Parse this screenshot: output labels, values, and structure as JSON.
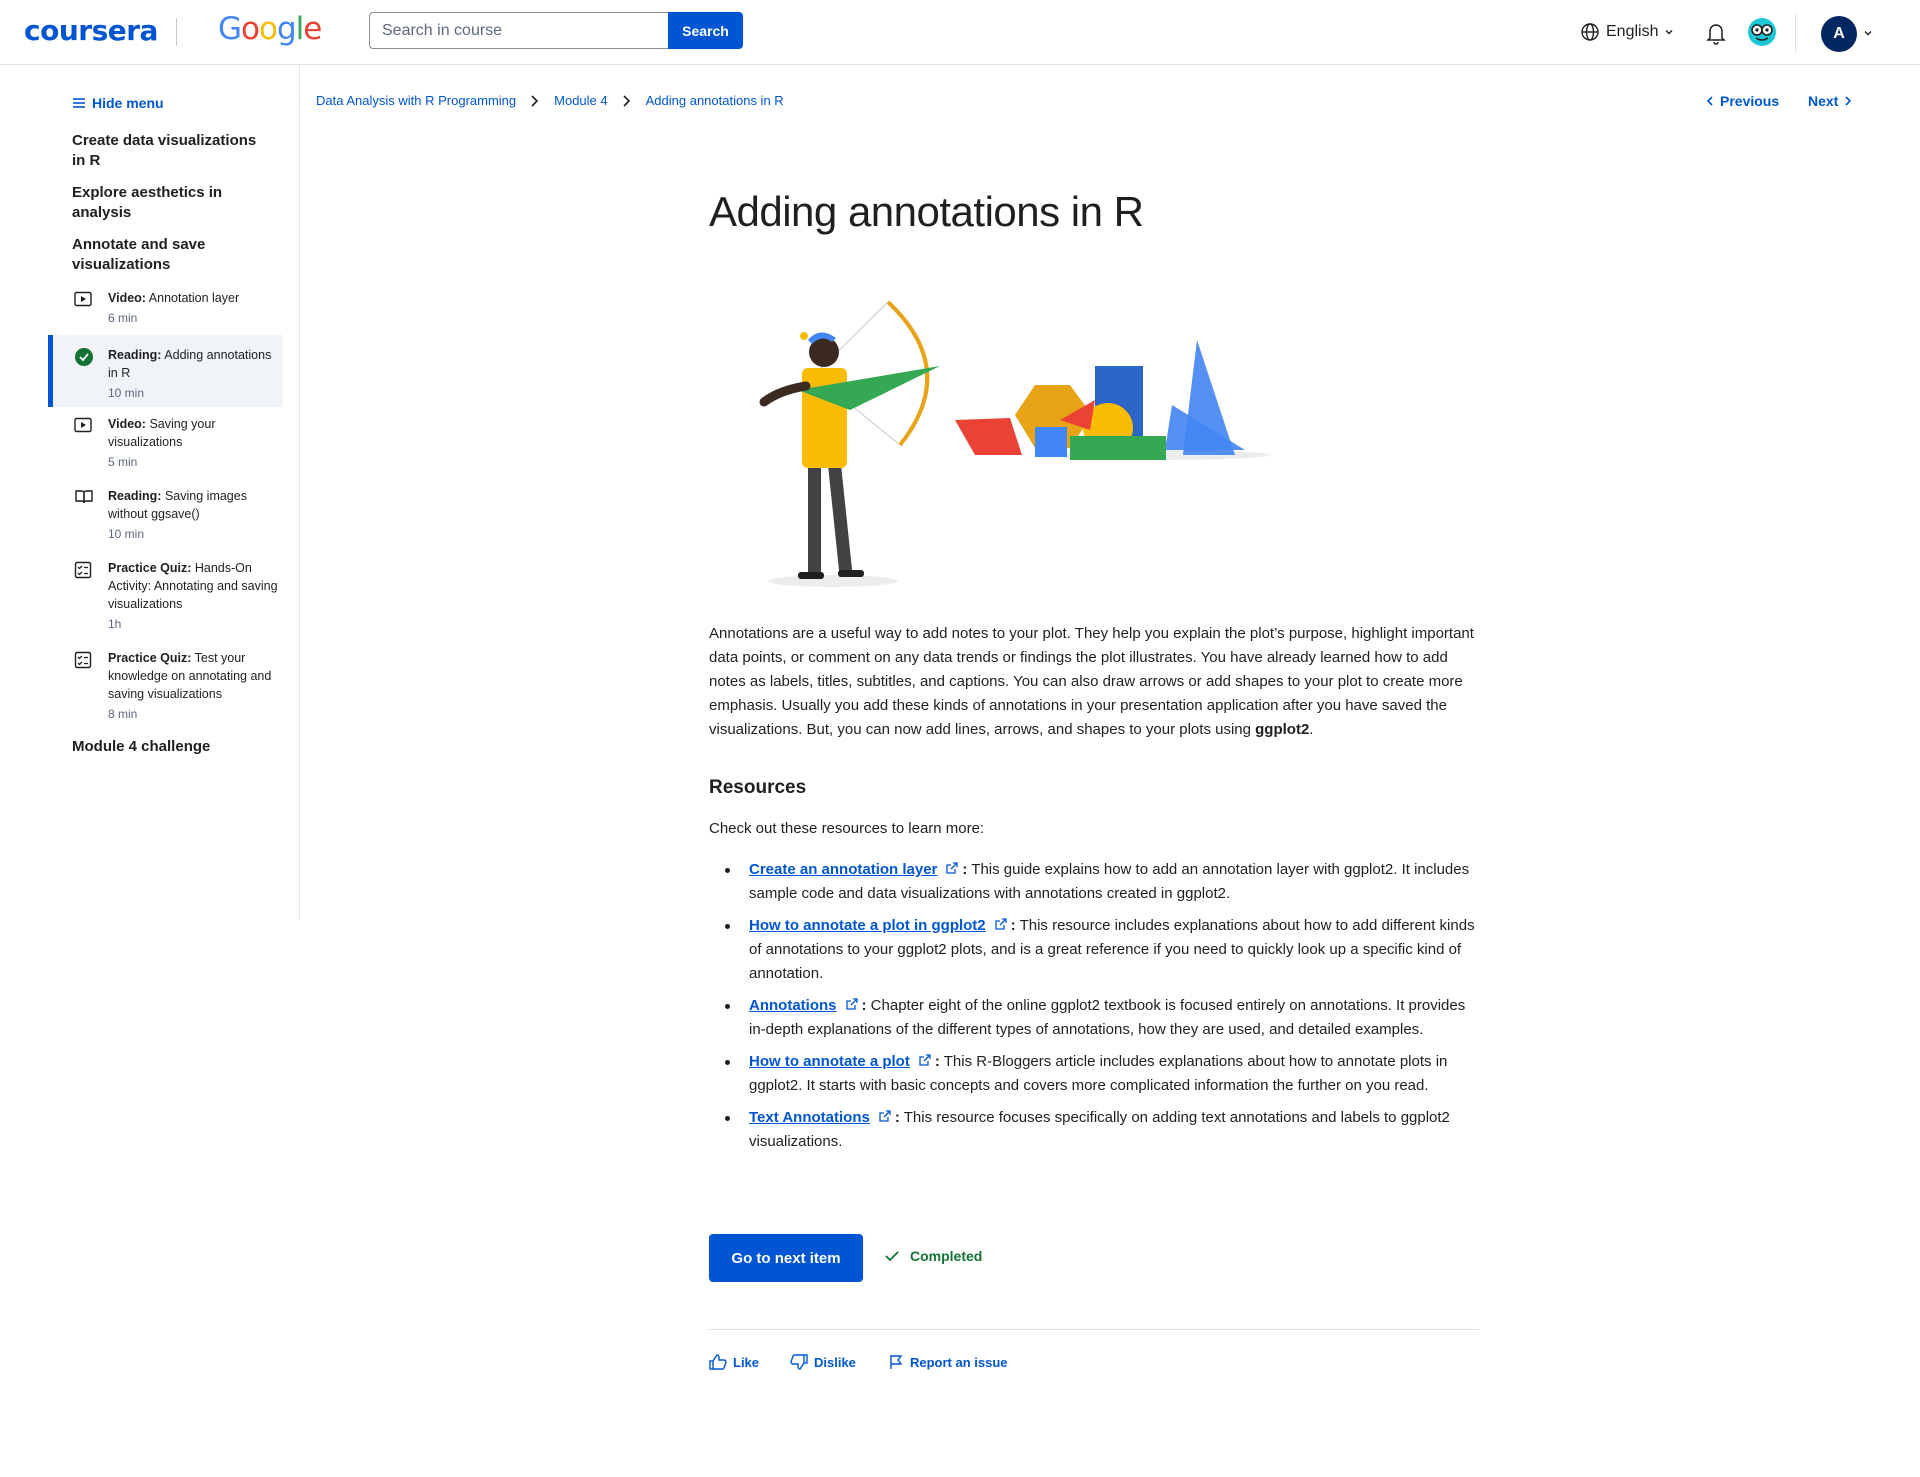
{
  "header": {
    "logo": "coursera",
    "partner_logo": "Google",
    "search": {
      "placeholder": "Search in course",
      "button": "Search"
    },
    "language": "English",
    "avatar_initial": "A"
  },
  "sidebar": {
    "hide_menu": "Hide menu",
    "sections": [
      "Create data visualizations in R",
      "Explore aesthetics in analysis",
      "Annotate and save visualizations"
    ],
    "items": [
      {
        "kind": "Video:",
        "title": "Annotation layer",
        "duration": "6 min",
        "icon": "video-icon",
        "active": false
      },
      {
        "kind": "Reading:",
        "title": "Adding annotations in R",
        "duration": "10 min",
        "icon": "completed-check-icon",
        "active": true
      },
      {
        "kind": "Video:",
        "title": "Saving your visualizations",
        "duration": "5 min",
        "icon": "video-icon",
        "active": false
      },
      {
        "kind": "Reading:",
        "title": "Saving images without ggsave()",
        "duration": "10 min",
        "icon": "book-icon",
        "active": false
      },
      {
        "kind": "Practice Quiz:",
        "title": "Hands-On Activity: Annotating and saving visualizations",
        "duration": "1h",
        "icon": "quiz-icon",
        "active": false
      },
      {
        "kind": "Practice Quiz:",
        "title": "Test your knowledge on annotating and saving visualizations",
        "duration": "8 min",
        "icon": "quiz-icon",
        "active": false
      }
    ],
    "final_section": "Module 4 challenge"
  },
  "breadcrumb": [
    "Data Analysis with R Programming",
    "Module 4",
    "Adding annotations in R"
  ],
  "nav": {
    "previous": "Previous",
    "next": "Next"
  },
  "main": {
    "title": "Adding annotations in R",
    "intro_before": "Annotations are a useful way to add notes to your plot. They help you explain the plot’s purpose, highlight important data points, or comment on any data trends or findings the plot illustrates. You have already learned how to add notes as labels, titles, subtitles, and captions. You can also draw arrows or add shapes to your plot to create more emphasis. Usually you add these kinds of annotations in your presentation application after you have saved the visualizations. But, you can now add lines, arrows, and shapes to your plots using ",
    "intro_bold": "ggplot2",
    "intro_after": ".",
    "resources_heading": "Resources",
    "resources_intro": "Check out these resources to learn more:",
    "resources": [
      {
        "link": "Create an annotation layer",
        "desc": "This guide explains how to add an annotation layer with ggplot2. It includes sample code and data visualizations with annotations created in ggplot2."
      },
      {
        "link": "How to annotate a plot in ggplot2",
        "desc": "This resource includes explanations about how to add different kinds of annotations to your ggplot2 plots, and is a great reference if you need to quickly look up a specific kind of annotation."
      },
      {
        "link": "Annotations",
        "desc": "Chapter eight of the online ggplot2 textbook is focused entirely on annotations. It provides in-depth explanations of the different types of annotations, how they are used, and detailed examples."
      },
      {
        "link": "How to annotate a plot",
        "desc": "This R-Bloggers article includes explanations about how to annotate plots in ggplot2. It starts with basic concepts and covers more complicated information the further on you read."
      },
      {
        "link": "Text Annotations",
        "desc": "This resource focuses specifically on adding text annotations and labels to ggplot2 visualizations."
      }
    ],
    "next_button": "Go to next item",
    "completed": "Completed",
    "feedback": {
      "like": "Like",
      "dislike": "Dislike",
      "report": "Report an issue"
    }
  },
  "colors": {
    "brand": "#0056d2",
    "success": "#137333",
    "text": "#1f1f1f",
    "muted": "#5b6780"
  }
}
